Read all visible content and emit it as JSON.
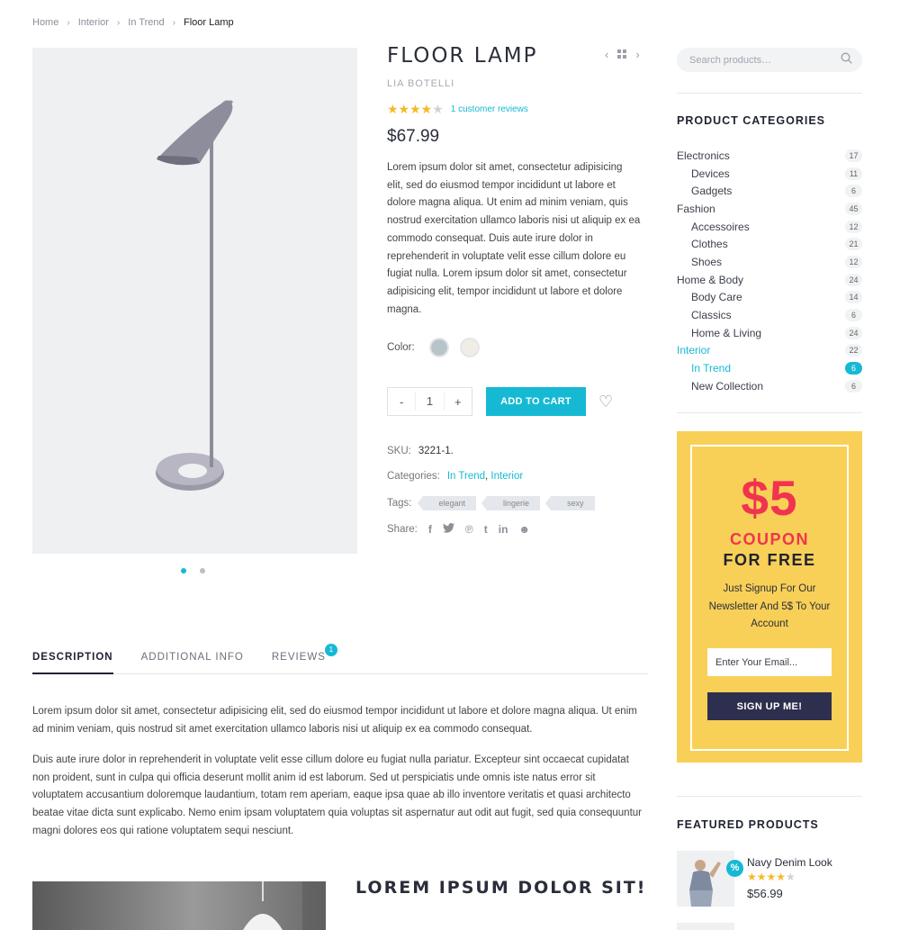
{
  "breadcrumb": [
    "Home",
    "Interior",
    "In Trend",
    "Floor Lamp"
  ],
  "product": {
    "title": "FLOOR LAMP",
    "brand": "LIA BOTELLI",
    "rating": 4,
    "rating_max": 5,
    "reviews_link": "1 customer reviews",
    "price": "$67.99",
    "description": "Lorem ipsum dolor sit amet, consectetur adipisicing elit, sed do eiusmod tempor incididunt ut labore et dolore magna aliqua. Ut enim ad minim veniam, quis nostrud exercitation ullamco laboris nisi ut aliquip ex ea commodo consequat. Duis aute irure dolor in reprehenderit in voluptate velit esse cillum dolore eu fugiat nulla. Lorem ipsum dolor sit amet, consectetur adipisicing elit, tempor incididunt ut labore et dolore magna.",
    "color_label": "Color:",
    "colors": [
      "#b7c5c9",
      "#efede4"
    ],
    "quantity_minus": "-",
    "quantity": "1",
    "quantity_plus": "+",
    "add_to_cart": "ADD TO CART",
    "sku_label": "SKU:",
    "sku": "3221-1.",
    "categories_label": "Categories:",
    "categories": [
      "In Trend",
      "Interior"
    ],
    "tags_label": "Tags:",
    "tags": [
      "elegant",
      "lingerie",
      "sexy"
    ],
    "share_label": "Share:",
    "share_icons": [
      "facebook-icon",
      "twitter-icon",
      "pinterest-icon",
      "tumblr-icon",
      "linkedin-icon",
      "reddit-icon"
    ]
  },
  "gallery": {
    "slides": 2,
    "active": 0
  },
  "tabs": [
    {
      "label": "DESCRIPTION",
      "active": true
    },
    {
      "label": "ADDITIONAL INFO",
      "active": false
    },
    {
      "label": "REVIEWS",
      "active": false,
      "badge": "1"
    }
  ],
  "tab_content": {
    "p1": "Lorem ipsum dolor sit amet, consectetur adipisicing elit, sed do eiusmod tempor incididunt ut labore et dolore magna aliqua. Ut enim ad minim veniam, quis nostrud sit amet exercitation ullamco laboris nisi ut aliquip ex ea commodo consequat.",
    "p2": "Duis aute irure dolor in reprehenderit in voluptate velit esse cillum dolore eu fugiat nulla pariatur. Excepteur sint occaecat cupidatat non proident, sunt in culpa qui officia deserunt mollit anim id est laborum. Sed ut perspiciatis unde omnis iste natus error sit voluptatem accusantium doloremque laudantium, totam rem aperiam, eaque ipsa quae ab illo inventore veritatis et quasi architecto beatae vitae dicta sunt explicabo. Nemo enim ipsam voluptatem quia voluptas sit aspernatur aut odit aut fugit, sed quia consequuntur magni dolores eos qui ratione voluptatem sequi nesciunt.",
    "heading": "LOREM IPSUM DOLOR SIT!"
  },
  "sidebar": {
    "search_placeholder": "Search products…",
    "categories_title": "PRODUCT CATEGORIES",
    "categories": [
      {
        "name": "Electronics",
        "count": "17",
        "sub": false
      },
      {
        "name": "Devices",
        "count": "11",
        "sub": true
      },
      {
        "name": "Gadgets",
        "count": "6",
        "sub": true
      },
      {
        "name": "Fashion",
        "count": "45",
        "sub": false
      },
      {
        "name": "Accessoires",
        "count": "12",
        "sub": true
      },
      {
        "name": "Clothes",
        "count": "21",
        "sub": true
      },
      {
        "name": "Shoes",
        "count": "12",
        "sub": true
      },
      {
        "name": "Home & Body",
        "count": "24",
        "sub": false
      },
      {
        "name": "Body Care",
        "count": "14",
        "sub": true
      },
      {
        "name": "Classics",
        "count": "6",
        "sub": true
      },
      {
        "name": "Home & Living",
        "count": "24",
        "sub": true
      },
      {
        "name": "Interior",
        "count": "22",
        "sub": false,
        "highlight": true
      },
      {
        "name": "In Trend",
        "count": "6",
        "sub": true,
        "highlight": true,
        "active": true
      },
      {
        "name": "New Collection",
        "count": "6",
        "sub": true
      }
    ],
    "coupon": {
      "amount": "$5",
      "word": "COUPON",
      "free": "FOR FREE",
      "text": "Just Signup For Our Newsletter And 5$ To Your Account",
      "email_placeholder": "Enter Your Email...",
      "button": "SIGN UP ME!"
    },
    "featured_title": "FEATURED PRODUCTS",
    "featured": [
      {
        "name": "Navy Denim Look",
        "rating": 4,
        "price": "$56.99",
        "badge": "%"
      }
    ]
  }
}
